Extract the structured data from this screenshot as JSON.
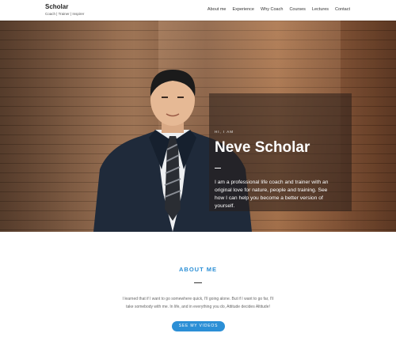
{
  "brand": {
    "title": "Scholar",
    "tagline": "Coach | Trainer | Inspirer"
  },
  "nav": {
    "items": [
      "About me",
      "Experience",
      "Why Coach",
      "Courses",
      "Lectures",
      "Contact"
    ]
  },
  "hero": {
    "greeting": "HI, I AM",
    "name": "Neve Scholar",
    "bio": "I am a professional life coach and trainer with an original love for nature, people and training. See how I can help you become a better version of yourself."
  },
  "about": {
    "title": "ABOUT ME",
    "text": "I learned that if I want to go somewhere quick, I'll going alone. But if I want to go far, I'll take somebody with me. In life, and in everything you do, Attitude decides Altitude!",
    "button_label": "SEE MY VIDEOS"
  },
  "colors": {
    "accent": "#2b8fd6",
    "overlay": "#281e19"
  }
}
